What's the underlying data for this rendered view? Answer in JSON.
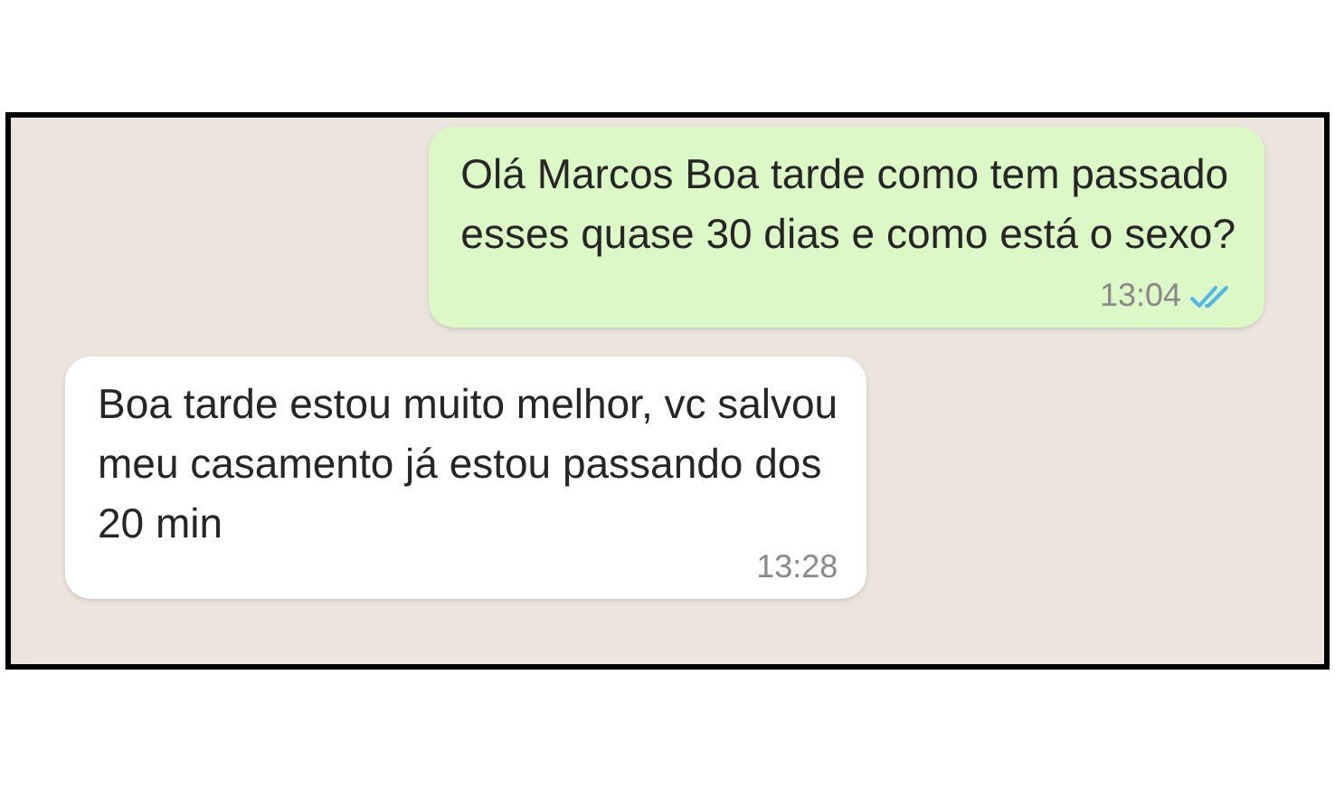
{
  "messages": [
    {
      "kind": "outgoing",
      "text": "Olá Marcos Boa tarde como tem passado\nesses quase 30 dias e como está o sexo?",
      "time": "13:04",
      "read": true
    },
    {
      "kind": "incoming",
      "text": "Boa tarde estou muito melhor, vc salvou\nmeu casamento já estou passando dos\n20 min",
      "time": "13:28"
    }
  ]
}
